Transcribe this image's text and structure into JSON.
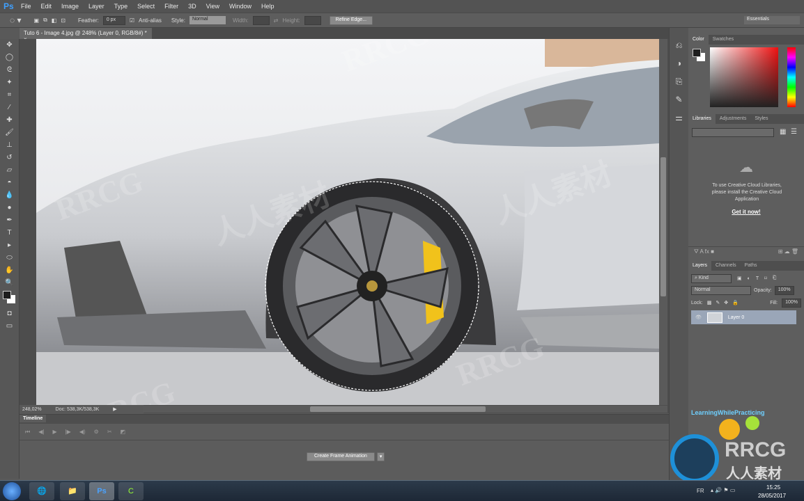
{
  "app": {
    "logo": "Ps"
  },
  "menu": [
    "File",
    "Edit",
    "Image",
    "Layer",
    "Type",
    "Select",
    "Filter",
    "3D",
    "View",
    "Window",
    "Help"
  ],
  "options": {
    "feather_label": "Feather:",
    "feather_value": "0 px",
    "antialias_label": "Anti-alias",
    "antialias_checked": true,
    "style_label": "Style:",
    "style_value": "Normal",
    "width_label": "Width:",
    "height_label": "Height:",
    "refine_edge": "Refine Edge...",
    "workspace": "Essentials"
  },
  "document": {
    "tab_title": "Tuto 6 - Image 4.jpg @ 248% (Layer 0, RGB/8#) *",
    "zoom": "248,02%",
    "doc_size": "Doc: 538,3K/538,3K"
  },
  "timeline": {
    "tab": "Timeline",
    "create_button": "Create Frame Animation"
  },
  "color_panel": {
    "tabs": [
      "Color",
      "Swatches"
    ],
    "foreground": "#1e1e1e",
    "background": "#ffffff",
    "hue": "#ff0000"
  },
  "libraries_panel": {
    "tabs": [
      "Libraries",
      "Adjustments",
      "Styles"
    ],
    "message": "To use Creative Cloud Libraries, please install the Creative Cloud Application",
    "link": "Get it now!"
  },
  "layers_panel": {
    "tabs": [
      "Layers",
      "Channels",
      "Paths"
    ],
    "filter": "Kind",
    "blend_mode": "Normal",
    "opacity_label": "Opacity:",
    "opacity": "100%",
    "lock_label": "Lock:",
    "fill_label": "Fill:",
    "fill": "100%",
    "layers": [
      {
        "name": "Layer 0",
        "visible": true,
        "selected": true
      }
    ]
  },
  "watermark": {
    "text1": "LearningWhilePracticing",
    "text2": "RRCG",
    "text3": "人人素材"
  },
  "taskbar": {
    "language": "FR",
    "time": "15:25",
    "date": "28/05/2017",
    "apps": [
      "chrome",
      "explorer",
      "photoshop",
      "camtasia"
    ]
  }
}
